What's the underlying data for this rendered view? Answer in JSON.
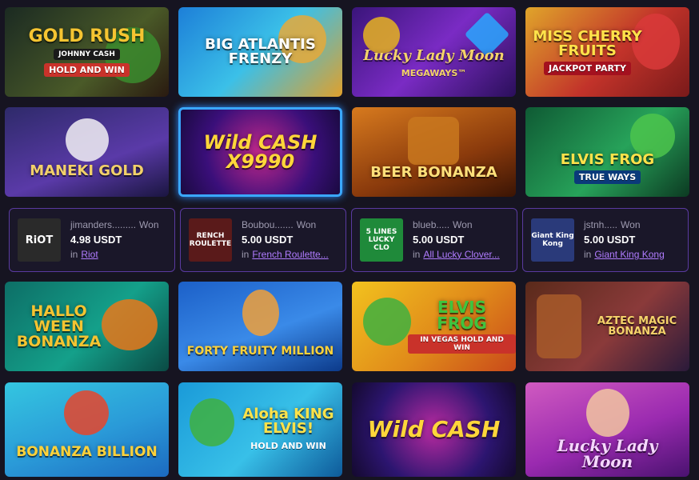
{
  "games_row1": [
    {
      "title": "GOLD RUSH",
      "sub": "HOLD AND WIN",
      "tag": "JOHNNY CASH",
      "bg": "#2a3b2c"
    },
    {
      "title": "BIG ATLANTIS FRENZY",
      "bg": "#1f5fc7"
    },
    {
      "title": "Lucky Lady Moon",
      "sub": "MEGAWAYS™",
      "bg": "#6a2cb8"
    },
    {
      "title": "MISS CHERRY FRUITS",
      "sub": "JACKPOT PARTY",
      "bg": "#c2332a"
    }
  ],
  "games_row2": [
    {
      "title": "MANEKI GOLD",
      "bg": "#3a2d78"
    },
    {
      "title": "Wild CASH X9990",
      "bg": "#2a1266"
    },
    {
      "title": "BEER BONANZA",
      "bg": "#b54a12"
    },
    {
      "title": "ELVIS FROG",
      "sub": "TRUE WAYS",
      "bg": "#1f8a4a"
    }
  ],
  "winners": [
    {
      "thumb": "RiOT",
      "user": "jimanders.........",
      "won": "Won",
      "amount": "4.98 USDT",
      "in": "in",
      "game": "Riot"
    },
    {
      "thumb": "RENCH ROULETTE",
      "user": "Boubou.......",
      "won": "Won",
      "amount": "5.00 USDT",
      "in": "in",
      "game": "French Roulette..."
    },
    {
      "thumb": "5 LINES LUCKY CLO",
      "user": "blueb.....",
      "won": "Won",
      "amount": "5.00 USDT",
      "in": "in",
      "game": "All Lucky Clover..."
    },
    {
      "thumb": "Giant King Kong",
      "user": "jstnh.....",
      "won": "Won",
      "amount": "5.00 USDT",
      "in": "in",
      "game": "Giant King Kong"
    }
  ],
  "games_row4": [
    {
      "title": "HALLO WEEN BONANZA",
      "bg": "#0f8a78"
    },
    {
      "title": "FORTY FRUITY MILLION",
      "bg": "#1e63c9"
    },
    {
      "title": "ELVIS FROG",
      "sub": "IN VEGAS HOLD AND WIN",
      "bg": "#d8b516"
    },
    {
      "title": "AZTEC MAGIC BONANZA",
      "bg": "#7a2f3a"
    }
  ],
  "games_row5": [
    {
      "title": "BONANZA BILLION",
      "bg": "#2fb7d6"
    },
    {
      "title": "Aloha KING ELVIS!",
      "sub": "HOLD AND WIN",
      "bg": "#1a8fd8"
    },
    {
      "title": "Wild CASH",
      "bg": "#2b1470"
    },
    {
      "title": "Lucky Lady Moon",
      "bg": "#b93fb0"
    }
  ],
  "colors": {
    "accent": "#b07cff",
    "selected_border": "#3aa8ff",
    "card_border": "#5a3aa0"
  }
}
